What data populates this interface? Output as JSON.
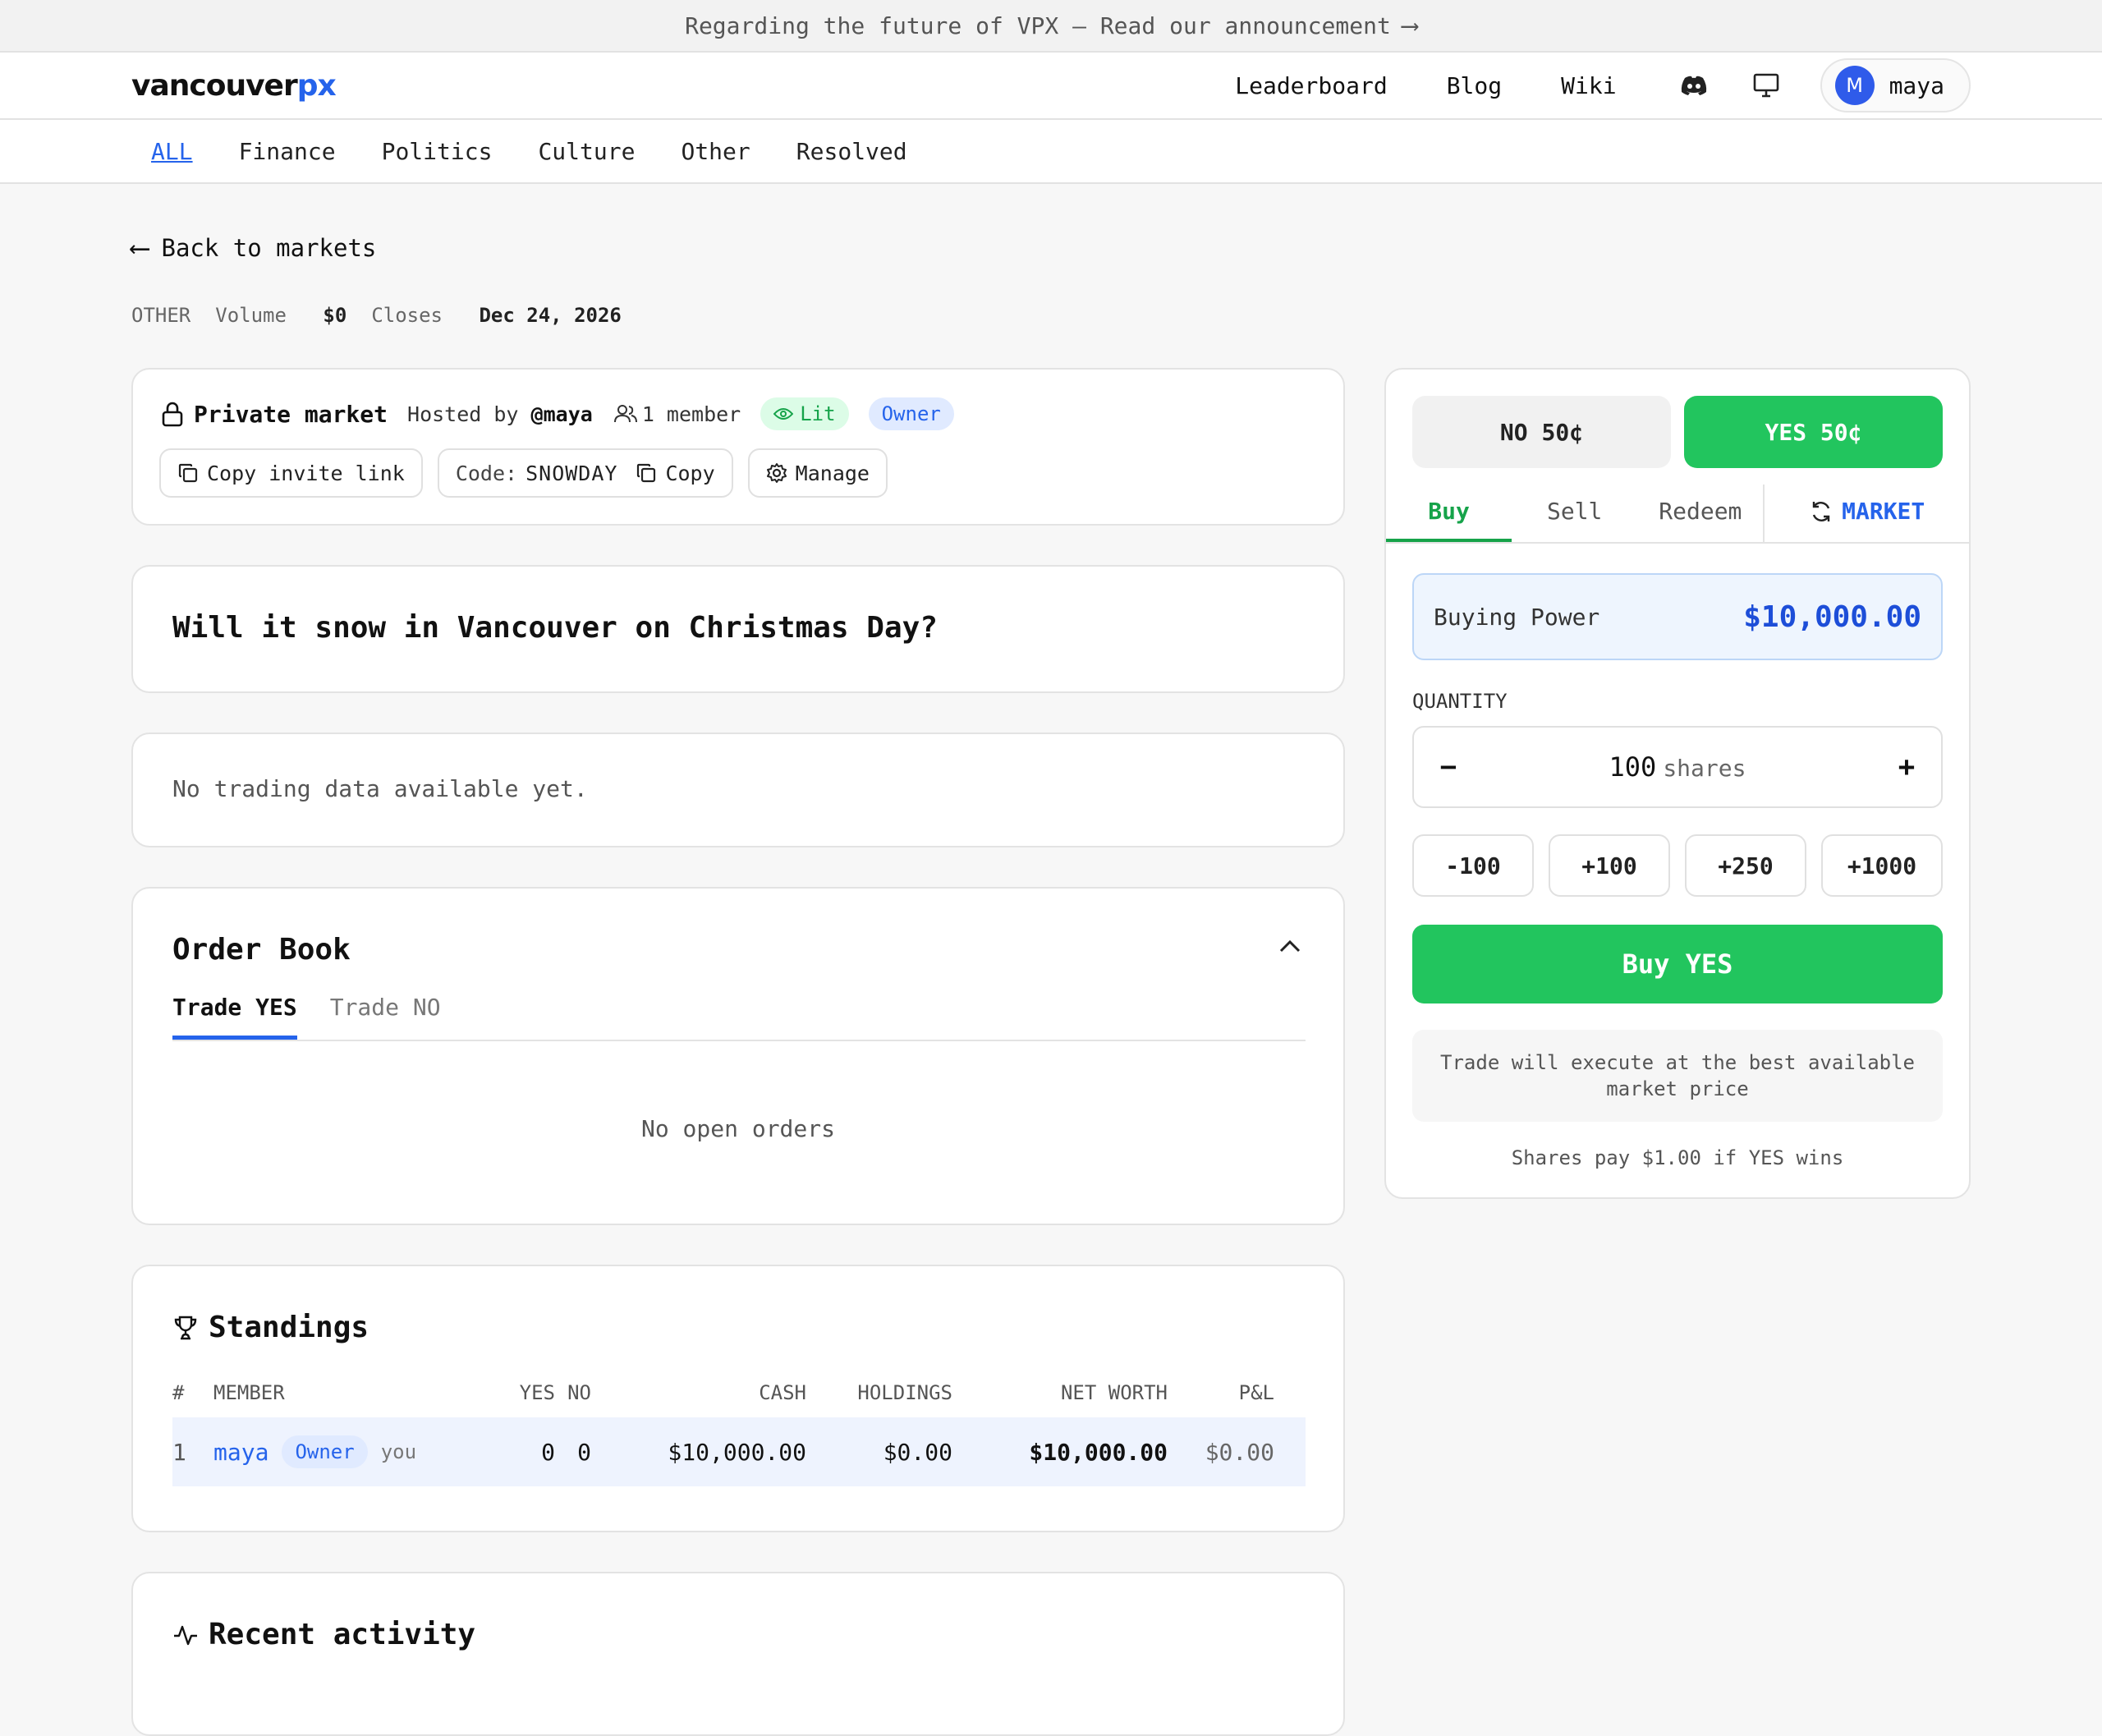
{
  "announcement": {
    "text": "Regarding the future of VPX — Read our announcement",
    "arrow": "⟶"
  },
  "brand": {
    "part1": "vancouver",
    "part2": "px",
    "accent_color": "#2563eb"
  },
  "nav": {
    "leaderboard": "Leaderboard",
    "blog": "Blog",
    "wiki": "Wiki",
    "discord_icon": "discord-icon",
    "display_icon": "monitor-icon"
  },
  "user": {
    "initial": "M",
    "name": "maya"
  },
  "categories": [
    "ALL",
    "Finance",
    "Politics",
    "Culture",
    "Other",
    "Resolved"
  ],
  "back": {
    "arrow": "⟵",
    "label": "Back to markets"
  },
  "meta": {
    "category": "OTHER",
    "volume_label": "Volume",
    "volume": "$0",
    "closes_label": "Closes",
    "closes": "Dec 24, 2026"
  },
  "private": {
    "title": "Private market",
    "hosted_prefix": "Hosted by",
    "host": "@maya",
    "members": "1 member",
    "lit": "Lit",
    "owner": "Owner",
    "copy_invite": "Copy invite link",
    "code_label": "Code:",
    "code": "SNOWDAY",
    "copy": "Copy",
    "manage": "Manage"
  },
  "question": "Will it snow in Vancouver on Christmas Day?",
  "no_trading": "No trading data available yet.",
  "orderbook": {
    "title": "Order Book",
    "tabs": [
      "Trade YES",
      "Trade NO"
    ],
    "empty": "No open orders"
  },
  "standings": {
    "title": "Standings",
    "headers": {
      "rank": "#",
      "member": "MEMBER",
      "yes": "YES",
      "no": "NO",
      "cash": "CASH",
      "holdings": "HOLDINGS",
      "net_worth": "NET WORTH",
      "pl": "P&L"
    },
    "rows": [
      {
        "rank": "1",
        "member": "maya",
        "badge": "Owner",
        "you": "you",
        "yes": "0",
        "no": "0",
        "cash": "$10,000.00",
        "holdings": "$0.00",
        "net_worth": "$10,000.00",
        "pl": "$0.00"
      }
    ]
  },
  "activity": {
    "title": "Recent activity"
  },
  "trade": {
    "no_label": "NO 50¢",
    "yes_label": "YES 50¢",
    "modes": [
      "Buy",
      "Sell",
      "Redeem"
    ],
    "order_type": "MARKET",
    "buying_power_label": "Buying Power",
    "buying_power": "$10,000.00",
    "quantity_label": "QUANTITY",
    "minus": "−",
    "plus": "+",
    "quantity": "100",
    "quantity_unit": "shares",
    "presets": [
      "-100",
      "+100",
      "+250",
      "+1000"
    ],
    "buy_button": "Buy YES",
    "note": "Trade will execute at the best available market price",
    "payout": "Shares pay $1.00 if YES wins",
    "yes_color": "#22c55e"
  }
}
